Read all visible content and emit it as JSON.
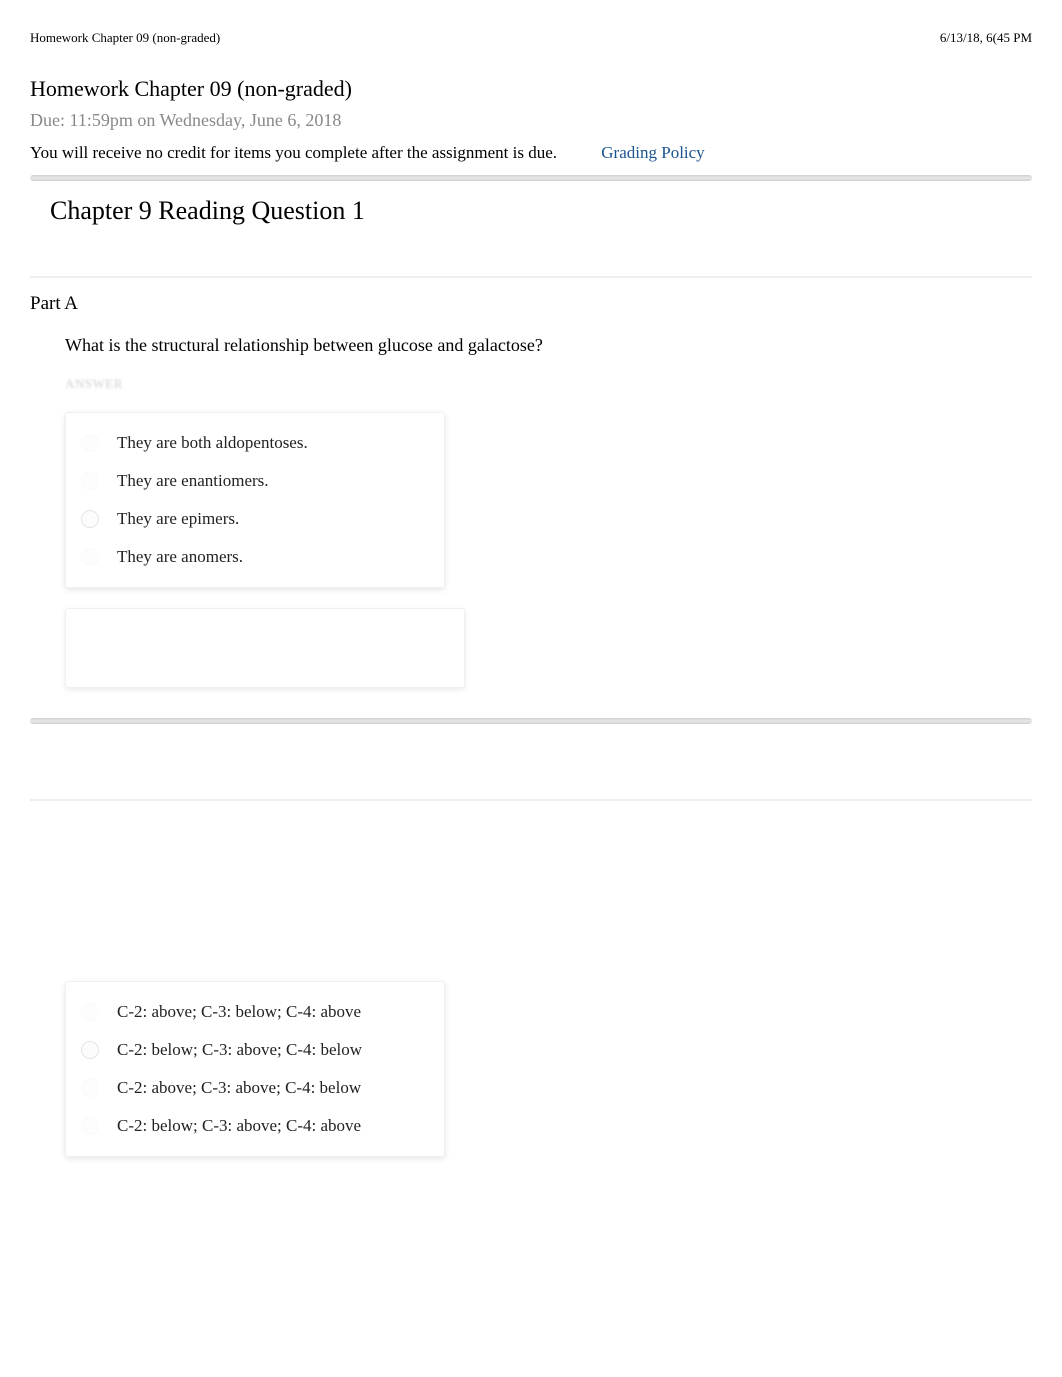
{
  "header": {
    "left": "Homework Chapter 09 (non-graded)",
    "right": "6/13/18, 6(45 PM"
  },
  "title": "Homework Chapter 09 (non-graded)",
  "due_date": "Due: 11:59pm on Wednesday, June 6, 2018",
  "credit_notice": "You will receive no credit for items you complete after the assignment is due.",
  "grading_policy": "Grading Policy",
  "question1": {
    "title": "Chapter 9 Reading Question 1",
    "part_label": "Part A",
    "question": "What is the structural relationship between glucose and galactose?",
    "answer_label": "ANSWER",
    "options": [
      "They are both aldopentoses.",
      "They are enantiomers.",
      "They are epimers.",
      "They are anomers."
    ],
    "selected_index": 2
  },
  "question2": {
    "options": [
      "C-2: above; C-3: below; C-4: above",
      "C-2: below; C-3: above; C-4: below",
      "C-2: above; C-3: above; C-4: below",
      "C-2: below; C-3: above; C-4: above"
    ],
    "selected_index": 1
  }
}
